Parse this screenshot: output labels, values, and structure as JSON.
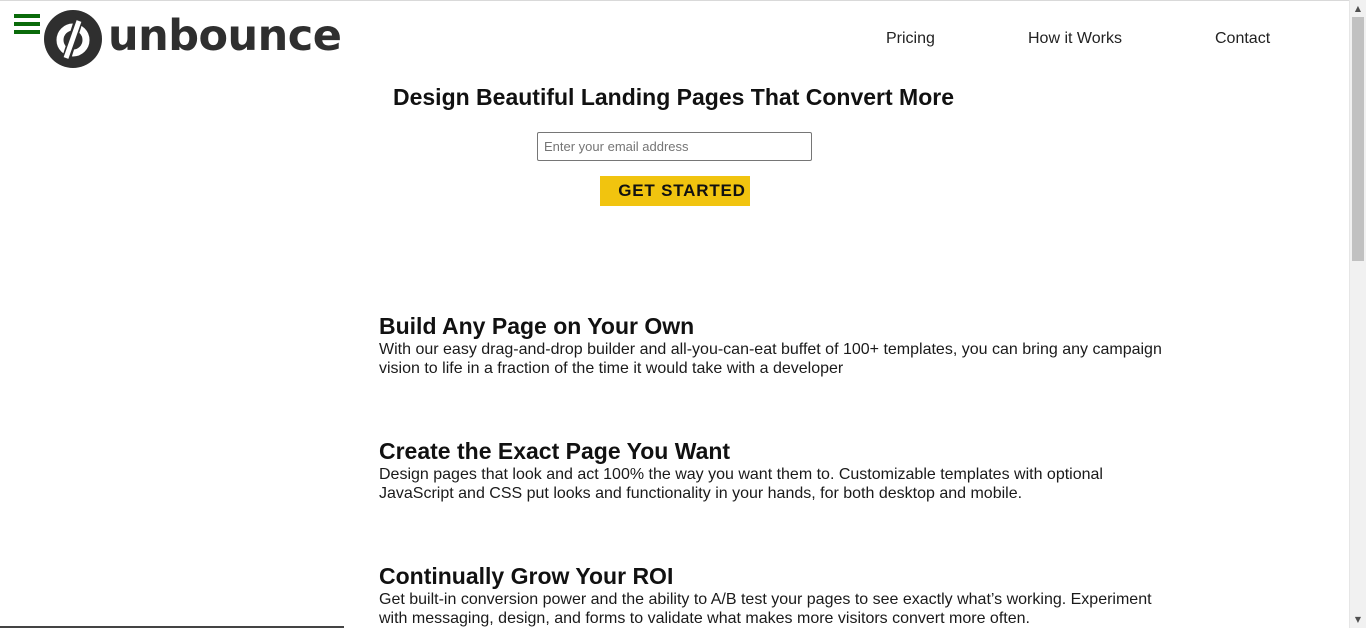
{
  "header": {
    "logo_text": "unbounce",
    "nav": [
      {
        "label": "Pricing"
      },
      {
        "label": "How it Works"
      },
      {
        "label": "Contact"
      }
    ]
  },
  "hero": {
    "title": "Design Beautiful Landing Pages That Convert More",
    "email_placeholder": "Enter your email address",
    "email_value": "",
    "cta_label": "GET STARTED"
  },
  "features": [
    {
      "title": "Build Any Page on Your Own",
      "text": "With our easy drag-and-drop builder and all-you-can-eat buffet of 100+ templates, you can bring any campaign vision to life in a fraction of the time it would take with a developer"
    },
    {
      "title": "Create the Exact Page You Want",
      "text": "Design pages that look and act 100% the way you want them to. Customizable templates with optional JavaScript and CSS put looks and functionality in your hands, for both desktop and mobile."
    },
    {
      "title": "Continually Grow Your ROI",
      "text": "Get built-in conversion power and the ability to A/B test your pages to see exactly what’s working. Experiment with messaging, design, and forms to validate what makes more visitors convert more often."
    }
  ],
  "icons": {
    "menu": "hamburger-menu-icon",
    "logo": "unbounce-logo-icon"
  },
  "colors": {
    "menu_icon": "#0a6b0a",
    "cta_background": "#f1c40f",
    "logo": "#2f2f2f"
  },
  "scrollbar": {
    "position_fraction": 0.0
  }
}
